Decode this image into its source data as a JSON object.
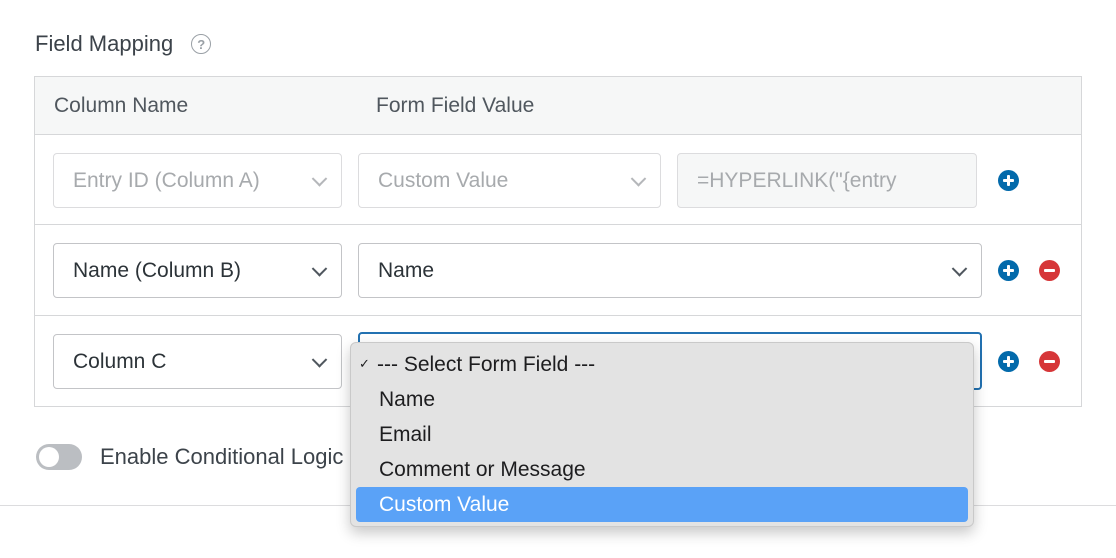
{
  "section": {
    "title": "Field Mapping",
    "help_icon": "?"
  },
  "table": {
    "headers": {
      "column_name": "Column Name",
      "form_field_value": "Form Field Value"
    },
    "rows": [
      {
        "column": "Entry ID (Column A)",
        "value": "Custom Value",
        "custom_text": "=HYPERLINK(\"{entry"
      },
      {
        "column": "Name (Column B)",
        "value": "Name"
      },
      {
        "column": "Column C",
        "value": ""
      }
    ]
  },
  "dropdown": {
    "check_mark": "✓",
    "options": [
      "--- Select Form Field ---",
      "Name",
      "Email",
      "Comment or Message",
      "Custom Value"
    ],
    "highlighted": "Custom Value"
  },
  "conditional_logic": {
    "label": "Enable Conditional Logic",
    "enabled": false
  },
  "colors": {
    "plus": "#036aab",
    "minus": "#d63638",
    "highlight": "#5aa2f7",
    "focus": "#2271b1"
  }
}
